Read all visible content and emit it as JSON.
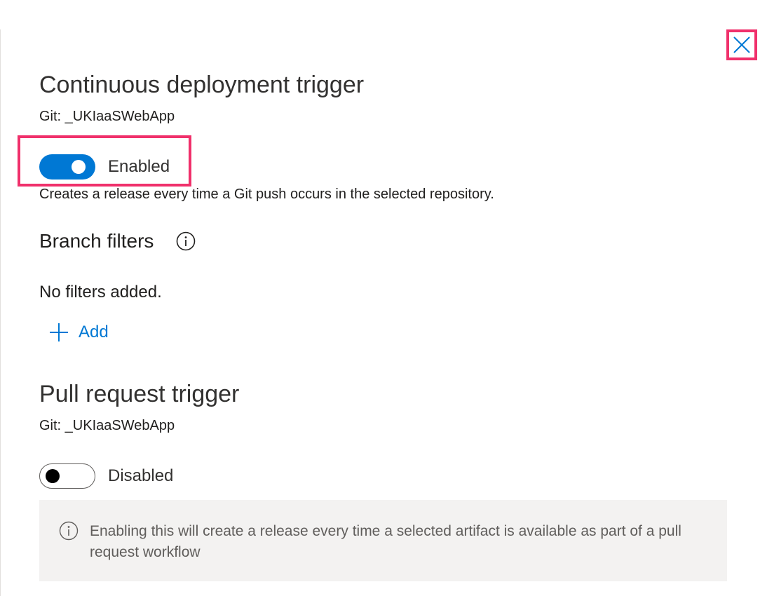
{
  "close": {
    "icon": "close-icon"
  },
  "cd_trigger": {
    "title": "Continuous deployment trigger",
    "source": "Git: _UKIaaSWebApp",
    "toggle_state": "on",
    "toggle_label": "Enabled",
    "description": "Creates a release every time a Git push occurs in the selected repository."
  },
  "branch_filters": {
    "title": "Branch filters",
    "info_icon": "info-icon",
    "empty_text": "No filters added.",
    "add_label": "Add",
    "add_icon": "plus-icon"
  },
  "pr_trigger": {
    "title": "Pull request trigger",
    "source": "Git: _UKIaaSWebApp",
    "toggle_state": "off",
    "toggle_label": "Disabled",
    "info_text": "Enabling this will create a release every time a selected artifact is available as part of a pull request workflow",
    "info_icon": "info-icon"
  },
  "colors": {
    "accent": "#0078d4",
    "highlight": "#f0306b",
    "info_bg": "#f3f2f1"
  }
}
